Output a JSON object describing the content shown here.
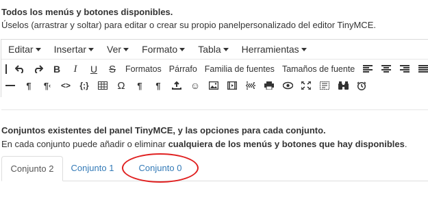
{
  "intro": {
    "title": "Todos los menús y botones disponibles.",
    "description": "Úselos (arrastrar y soltar) para editar o crear su propio panelpersonalizado del editor TinyMCE."
  },
  "menubar": [
    {
      "label": "Editar"
    },
    {
      "label": "Insertar"
    },
    {
      "label": "Ver"
    },
    {
      "label": "Formato"
    },
    {
      "label": "Tabla"
    },
    {
      "label": "Herramientas"
    }
  ],
  "toolbar": {
    "formats_label": "Formatos",
    "paragraph_label": "Párrafo",
    "font_family_label": "Familia de fuentes",
    "font_size_label": "Tamaños de fuente"
  },
  "sets": {
    "title": "Conjuntos existentes del panel TinyMCE, y las opciones para cada conjunto.",
    "desc_prefix": "En cada conjunto puede añadir o eliminar ",
    "desc_bold": "cualquiera de los menús y botones que hay disponibles",
    "desc_suffix": "."
  },
  "tabs": [
    {
      "label": "Conjunto 2",
      "active": true
    },
    {
      "label": "Conjunto 1",
      "active": false
    },
    {
      "label": "Conjunto 0",
      "active": false
    }
  ],
  "colors": {
    "link": "#337ab7",
    "highlight": "#e02020",
    "text": "#333333"
  }
}
